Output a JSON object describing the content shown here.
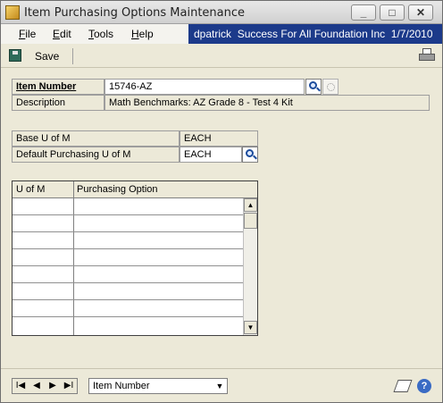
{
  "window": {
    "title": "Item Purchasing Options Maintenance",
    "controls": {
      "minimize": "_",
      "maximize": "□",
      "close": "✕"
    }
  },
  "menu": {
    "items": [
      {
        "label_acc": "F",
        "label_rest": "ile"
      },
      {
        "label_acc": "E",
        "label_rest": "dit"
      },
      {
        "label_acc": "T",
        "label_rest": "ools"
      },
      {
        "label_acc": "H",
        "label_rest": "elp"
      }
    ]
  },
  "userbar": {
    "user": "dpatrick",
    "company": "Success For All Foundation Inc",
    "date": "1/7/2010"
  },
  "toolbar": {
    "save_label": "Save",
    "save_icon": "floppy-disk-icon",
    "print_icon": "printer-icon"
  },
  "item": {
    "number_label": "Item Number",
    "number_value": "15746-AZ",
    "description_label": "Description",
    "description_value": "Math Benchmarks: AZ Grade 8 - Test 4 Kit"
  },
  "uom": {
    "base_label": "Base U of M",
    "base_value": "EACH",
    "default_purchasing_label": "Default Purchasing U of M",
    "default_purchasing_value": "EACH"
  },
  "grid": {
    "columns": [
      "U of M",
      "Purchasing Option"
    ],
    "rows": [
      [
        "",
        ""
      ],
      [
        "",
        ""
      ],
      [
        "",
        ""
      ],
      [
        "",
        ""
      ],
      [
        "",
        ""
      ],
      [
        "",
        ""
      ],
      [
        "",
        ""
      ],
      [
        "",
        ""
      ]
    ]
  },
  "bottom": {
    "nav": {
      "first": "I◀",
      "prev": "◀",
      "next": "▶",
      "last": "▶I"
    },
    "sort_by": "Item Number",
    "note_icon": "note-icon",
    "help_icon": "help-icon"
  },
  "colors": {
    "userbar_bg": "#1c3a8a",
    "window_bg": "#ece9d8",
    "lookup_icon": "#1c4c9c"
  }
}
